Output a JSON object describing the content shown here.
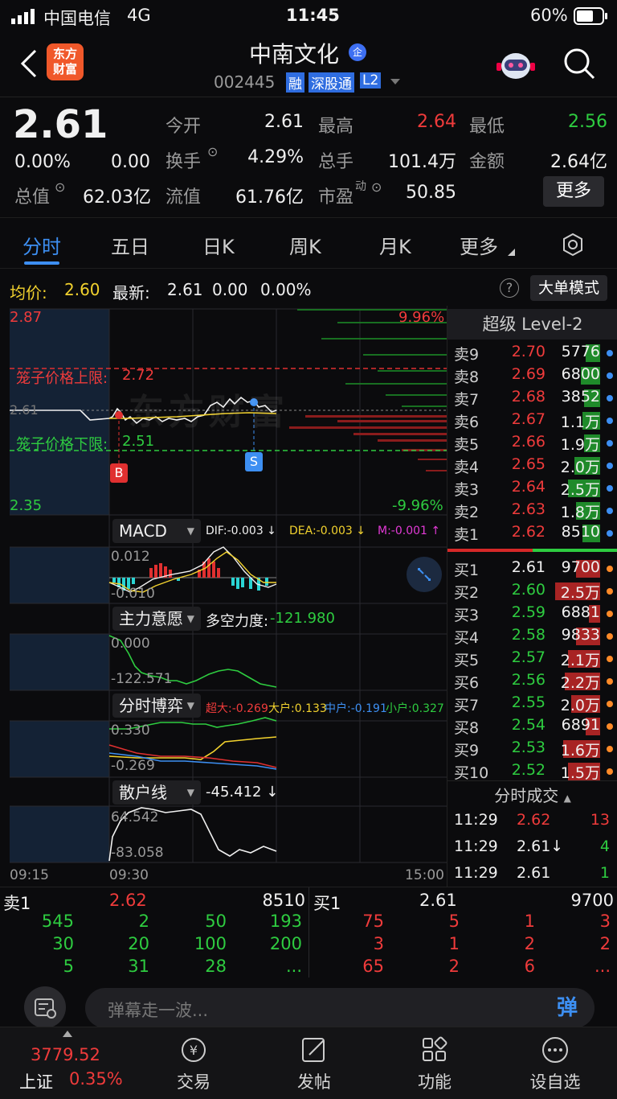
{
  "status": {
    "carrier": "中国电信",
    "network": "4G",
    "time": "11:45",
    "battery": "60%"
  },
  "nav": {
    "logo_line1": "东方",
    "logo_line2": "财富",
    "stock_name": "中南文化",
    "badge": "企",
    "code": "002445",
    "tag_rong": "融",
    "tag_sgt": "深股通",
    "tag_l2": "L2"
  },
  "quote": {
    "price": "2.61",
    "change_pct": "0.00%",
    "change": "0.00",
    "open_label": "今开",
    "open": "2.61",
    "high_label": "最高",
    "high": "2.64",
    "low_label": "最低",
    "low": "2.56",
    "turnover_label": "换手",
    "turnover": "4.29%",
    "volume_label": "总手",
    "volume": "101.4万",
    "amount_label": "金额",
    "amount": "2.64亿",
    "mktcap_label": "总值",
    "mktcap": "62.03亿",
    "float_label": "流值",
    "float": "61.76亿",
    "pe_label": "市盈",
    "pe_sup": "动",
    "pe": "50.85",
    "more_button": "更多"
  },
  "tabs": [
    "分时",
    "五日",
    "日K",
    "周K",
    "月K",
    "更多"
  ],
  "avg": {
    "avg_label": "均价:",
    "avg": "2.60",
    "latest_label": "最新:",
    "latest": "2.61",
    "chg": "0.00",
    "pct": "0.00%",
    "help": "?",
    "big_order_button": "大单模式"
  },
  "chart": {
    "y_top": "2.87",
    "y_bottom": "2.35",
    "pct_top": "9.96%",
    "pct_bottom": "-9.96%",
    "upper_limit_label": "笼子价格上限:",
    "upper_limit": "2.72",
    "lower_limit_label": "笼子价格下限:",
    "lower_limit": "2.51",
    "price_mark": "2.61",
    "watermark": "东方财富",
    "buy_mark": "B",
    "sell_mark": "S",
    "macd_label": "MACD",
    "dif": "DIF:-0.003 ↓",
    "dea": "DEA:-0.003 ↓",
    "m": "M:-0.001 ↑",
    "macd_top": "0.012",
    "macd_bottom": "-0.010",
    "zl_label": "主力意愿",
    "zl_text": "多空力度:",
    "zl_val": "-121.980",
    "zl_top": "0.000",
    "zl_bottom": "-122.571",
    "bo_label": "分时博弈",
    "bo_cd": "超大:-0.269",
    "bo_dh": "大户:0.133",
    "bo_zh": "中户:-0.191",
    "bo_xh": "小户:0.327",
    "bo_top": "0.330",
    "bo_bottom": "-0.269",
    "sh_label": "散户线",
    "sh_val": "-45.412 ↓",
    "sh_top": "64.542",
    "sh_bottom": "-83.058",
    "t_start": "09:15",
    "t_open": "09:30",
    "t_end": "15:00"
  },
  "level2": {
    "title": "超级 Level-2",
    "asks": [
      {
        "k": "卖9",
        "p": "2.70",
        "v": "5776"
      },
      {
        "k": "卖8",
        "p": "2.69",
        "v": "6800"
      },
      {
        "k": "卖7",
        "p": "2.68",
        "v": "3852"
      },
      {
        "k": "卖6",
        "p": "2.67",
        "v": "1.1万"
      },
      {
        "k": "卖5",
        "p": "2.66",
        "v": "1.9万"
      },
      {
        "k": "卖4",
        "p": "2.65",
        "v": "2.0万"
      },
      {
        "k": "卖3",
        "p": "2.64",
        "v": "2.5万"
      },
      {
        "k": "卖2",
        "p": "2.63",
        "v": "1.8万"
      },
      {
        "k": "卖1",
        "p": "2.62",
        "v": "8510"
      }
    ],
    "bids": [
      {
        "k": "买1",
        "p": "2.61",
        "v": "9700"
      },
      {
        "k": "买2",
        "p": "2.60",
        "v": "2.5万"
      },
      {
        "k": "买3",
        "p": "2.59",
        "v": "6881"
      },
      {
        "k": "买4",
        "p": "2.58",
        "v": "9833"
      },
      {
        "k": "买5",
        "p": "2.57",
        "v": "2.1万"
      },
      {
        "k": "买6",
        "p": "2.56",
        "v": "2.2万"
      },
      {
        "k": "买7",
        "p": "2.55",
        "v": "2.0万"
      },
      {
        "k": "买8",
        "p": "2.54",
        "v": "6891"
      },
      {
        "k": "买9",
        "p": "2.53",
        "v": "1.6万"
      },
      {
        "k": "买10",
        "p": "2.52",
        "v": "1.5万"
      }
    ],
    "trades_title": "分时成交",
    "trades": [
      {
        "t": "11:29",
        "p": "2.62",
        "v": "13"
      },
      {
        "t": "11:29",
        "p": "2.61↓",
        "v": "4"
      },
      {
        "t": "11:29",
        "p": "2.61",
        "v": "1"
      }
    ]
  },
  "bottom_quote": {
    "ask_label": "卖1",
    "ask_price": "2.62",
    "ask_vol": "8510",
    "bid_label": "买1",
    "bid_price": "2.61",
    "bid_vol": "9700",
    "ask_rows": [
      [
        "545",
        "2",
        "50",
        "193"
      ],
      [
        "30",
        "20",
        "100",
        "200"
      ],
      [
        "5",
        "31",
        "28",
        "..."
      ]
    ],
    "bid_rows": [
      [
        "75",
        "5",
        "1",
        "3"
      ],
      [
        "3",
        "1",
        "2",
        "2"
      ],
      [
        "65",
        "2",
        "6",
        "..."
      ]
    ]
  },
  "danmu": {
    "placeholder": "弹幕走一波...",
    "button": "弹"
  },
  "tabbar": {
    "index_value": "3779.52",
    "index_name": "上证",
    "index_pct": "0.35%",
    "items": [
      "交易",
      "发帖",
      "功能",
      "设自选"
    ]
  }
}
